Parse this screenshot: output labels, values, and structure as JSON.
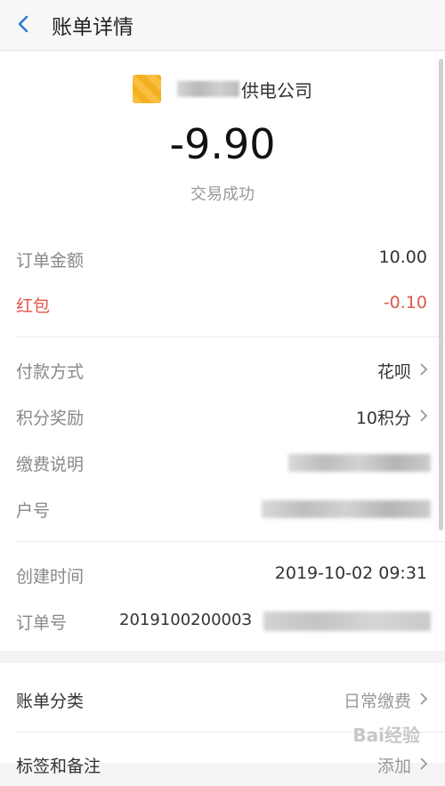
{
  "nav": {
    "title": "账单详情"
  },
  "merchant": {
    "name_visible": "供电公司"
  },
  "transaction": {
    "amount": "-9.90",
    "status": "交易成功"
  },
  "order": {
    "amount_label": "订单金额",
    "amount_value": "10.00",
    "redpacket_label": "红包",
    "redpacket_value": "-0.10"
  },
  "payment": {
    "method_label": "付款方式",
    "method_value": "花呗",
    "points_label": "积分奖励",
    "points_value": "10积分",
    "fee_note_label": "缴费说明",
    "account_label": "户号"
  },
  "meta": {
    "created_label": "创建时间",
    "created_value": "2019-10-02 09:31",
    "order_no_label": "订单号",
    "order_no_visible": "201910020000З"
  },
  "category": {
    "label": "账单分类",
    "value": "日常缴费",
    "tags_label": "标签和备注",
    "tags_value": "添加"
  },
  "watermark": "Bai经验",
  "colors": {
    "red": "#e0564a",
    "blue": "#2a7fd4"
  }
}
